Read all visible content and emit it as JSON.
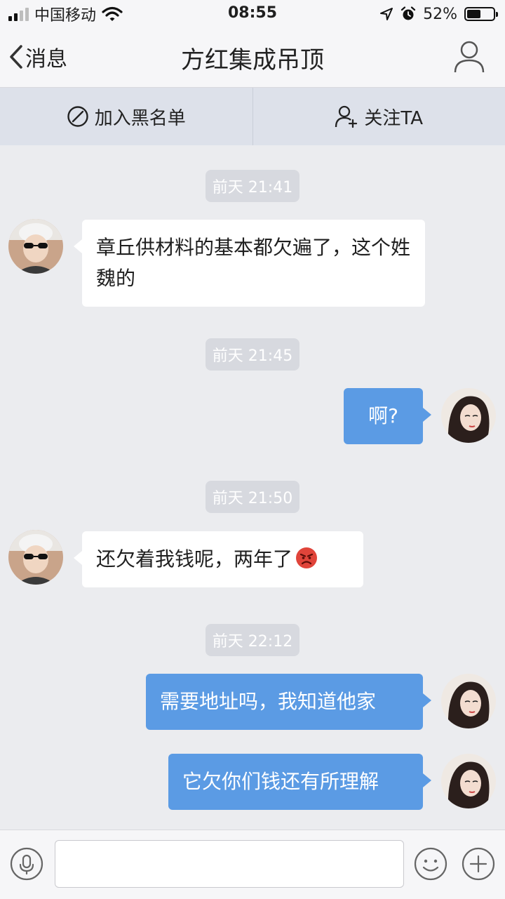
{
  "status_bar": {
    "carrier": "中国移动",
    "time": "08:55",
    "battery_percent": "52%",
    "battery_level": 0.52,
    "icons": [
      "signal-bars-icon",
      "wifi-icon",
      "location-arrow-icon",
      "alarm-icon",
      "battery-icon"
    ]
  },
  "nav": {
    "back_label": "消息",
    "title": "方红集成吊顶",
    "profile_icon": "person-icon"
  },
  "actions": {
    "blacklist_label": "加入黑名单",
    "follow_label": "关注TA"
  },
  "messages": [
    {
      "type": "timestamp",
      "text": "前天 21:41"
    },
    {
      "type": "message",
      "side": "in",
      "text": "章丘供材料的基本都欠遍了，这个姓魏的"
    },
    {
      "type": "timestamp",
      "text": "前天 21:45"
    },
    {
      "type": "message",
      "side": "out",
      "text": "啊?"
    },
    {
      "type": "timestamp",
      "text": "前天 21:50"
    },
    {
      "type": "message",
      "side": "in",
      "text": "还欠着我钱呢，两年了",
      "emoji": "angry-face-icon"
    },
    {
      "type": "timestamp",
      "text": "前天 22:12"
    },
    {
      "type": "message",
      "side": "out",
      "text": "需要地址吗，我知道他家"
    },
    {
      "type": "message",
      "side": "out",
      "text": "它欠你们钱还有所理解"
    }
  ],
  "input": {
    "placeholder": "",
    "value": ""
  },
  "colors": {
    "outgoing_bubble": "#5b9be4",
    "incoming_bubble": "#ffffff",
    "chat_background": "#ebecef",
    "action_bar": "#dde1ea"
  }
}
